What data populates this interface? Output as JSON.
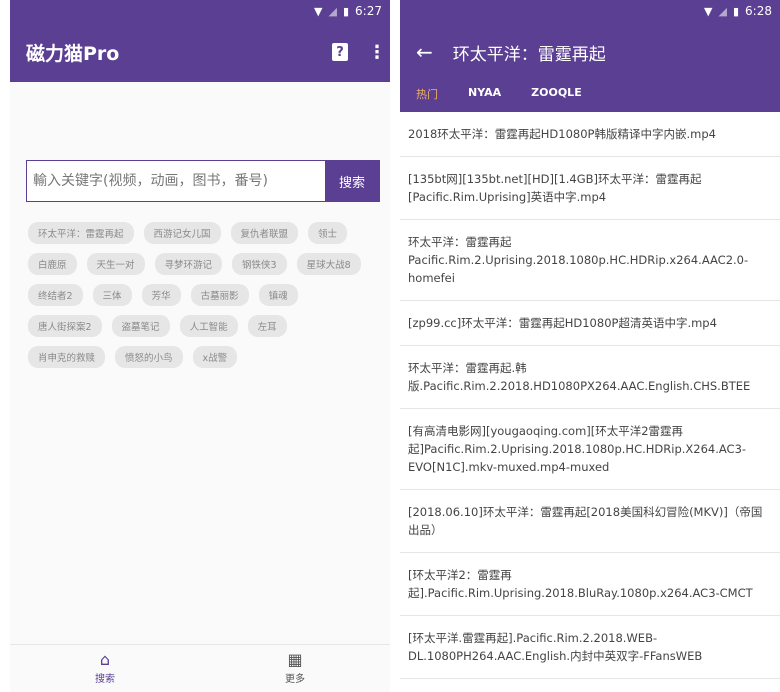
{
  "left": {
    "status": {
      "time": "6:27"
    },
    "app_bar": {
      "title": "磁力猫Pro"
    },
    "search": {
      "placeholder": "輸入关键字(视频，动画，图书，番号)",
      "button_label": "搜索"
    },
    "tags": [
      [
        "环太平洋：雷霆再起",
        "西游记女儿国",
        "复仇者联盟",
        "领士"
      ],
      [
        "白鹿原",
        "天生一对",
        "寻梦环游记",
        "钢铁侠3",
        "星球大战8"
      ],
      [
        "终结者2",
        "三体",
        "芳华",
        "古墓丽影",
        "镇魂"
      ],
      [
        "唐人街探案2",
        "盗墓笔记",
        "人工智能",
        "左耳"
      ],
      [
        "肖申克的救赎",
        "愤怒的小鸟",
        "x战警"
      ]
    ],
    "bottom_nav": {
      "search_label": "搜索",
      "more_label": "更多"
    }
  },
  "right": {
    "status": {
      "time": "6:28"
    },
    "app_bar": {
      "title": "环太平洋：雷霆再起"
    },
    "tabs": [
      "热门",
      "NYAA",
      "ZOOQLE"
    ],
    "results": [
      "2018环太平洋：雷霆再起HD1080P韩版精译中字内嵌.mp4",
      "[135bt网][135bt.net][HD][1.4GB]环太平洋：雷霆再起[Pacific.Rim.Uprising]英语中字.mp4",
      "环太平洋：雷霆再起 Pacific.Rim.2.Uprising.2018.1080p.HC.HDRip.x264.AAC2.0-homefei",
      "[zp99.cc]环太平洋：雷霆再起HD1080P超清英语中字.mp4",
      "环太平洋：雷霆再起.韩版.Pacific.Rim.2.2018.HD1080PX264.AAC.English.CHS.BTEE",
      "[有高清电影网][yougaoqing.com][环太平洋2雷霆再起]Pacific.Rim.2.Uprising.2018.1080p.HC.HDRip.X264.AC3-EVO[N1C].mkv-muxed.mp4-muxed",
      "[2018.06.10]环太平洋：雷霆再起[2018美国科幻冒险(MKV)]（帝国出品）",
      "[环太平洋2：雷霆再起].Pacific.Rim.Uprising.2018.BluRay.1080p.x264.AC3-CMCT",
      "[环太平洋.雷霆再起].Pacific.Rim.2.2018.WEB-DL.1080PH264.AAC.English.内封中英双字-FFansWEB"
    ]
  },
  "theme": {
    "primary": "#5b3f93",
    "tab_active": "#f2b35c",
    "tag_bg": "#e6e6e6"
  }
}
